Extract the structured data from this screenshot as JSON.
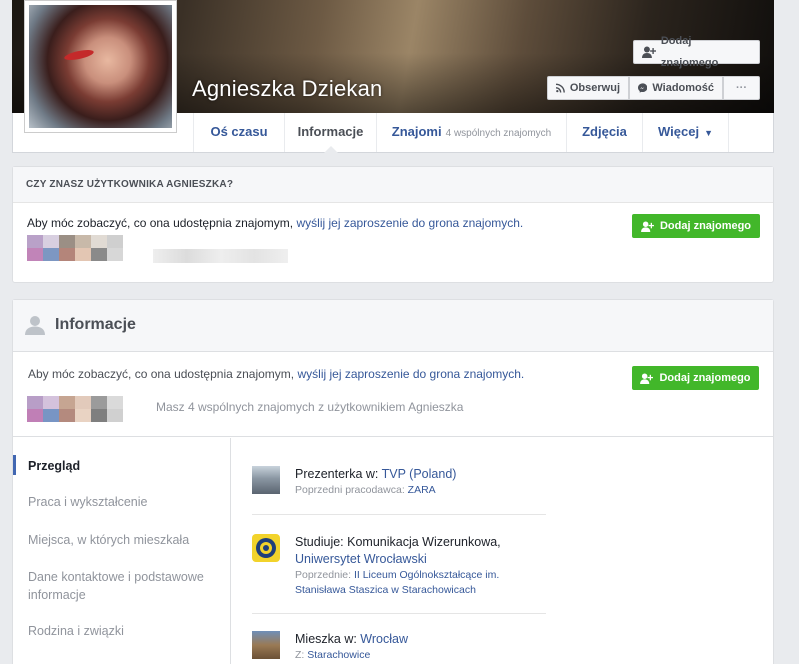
{
  "profile": {
    "name": "Agnieszka Dziekan"
  },
  "cover_buttons": {
    "add_friend": "Dodaj znajomego",
    "follow": "Obserwuj",
    "message": "Wiadomość",
    "more": "···"
  },
  "tabs": [
    {
      "label": "Oś czasu"
    },
    {
      "label": "Informacje"
    },
    {
      "label": "Znajomi",
      "sub": "4 wspólnych znajomych"
    },
    {
      "label": "Zdjęcia"
    },
    {
      "label": "Więcej",
      "caret": "▼"
    }
  ],
  "know_box": {
    "header": "CZY ZNASZ UŻYTKOWNIKA AGNIESZKA?",
    "text": "Aby móc zobaczyć, co ona udostępnia znajomym,",
    "link": "wyślij jej zaproszenie do grona znajomych.",
    "button": "Dodaj znajomego"
  },
  "info_section": {
    "title": "Informacje",
    "text": "Aby móc zobaczyć, co ona udostępnia znajomym,",
    "link": "wyślij jej zaproszenie do grona znajomych.",
    "button": "Dodaj znajomego",
    "mutual": "Masz 4 wspólnych znajomych z użytkownikiem Agnieszka"
  },
  "left_nav": [
    {
      "label": "Przegląd"
    },
    {
      "label": "Praca i wykształcenie"
    },
    {
      "label": "Miejsca, w których mieszkała"
    },
    {
      "label": "Dane kontaktowe i podstawowe informacje"
    },
    {
      "label": "Rodzina i związki"
    }
  ],
  "entries": {
    "work": {
      "prefix": "Prezenterka w: ",
      "link": "TVP (Poland)",
      "sub_prefix": "Poprzedni pracodawca: ",
      "sub_link": "ZARA"
    },
    "study": {
      "prefix": "Studiuje: Komunikacja Wizerunkowa,",
      "link": "Uniwersytet Wrocławski",
      "sub_prefix": "Poprzednie: ",
      "sub_link_1": "II Liceum Ogólnokształcące im.",
      "sub_link_2": "Stanisława Staszica w Starachowicach"
    },
    "lives": {
      "prefix": "Mieszka w: ",
      "link": "Wrocław",
      "sub_prefix": "Z: ",
      "sub_link": "Starachowice"
    }
  },
  "colors": {
    "link": "#365899",
    "green": "#42b72a",
    "accent": "#4267b2",
    "muted": "#90949c"
  }
}
